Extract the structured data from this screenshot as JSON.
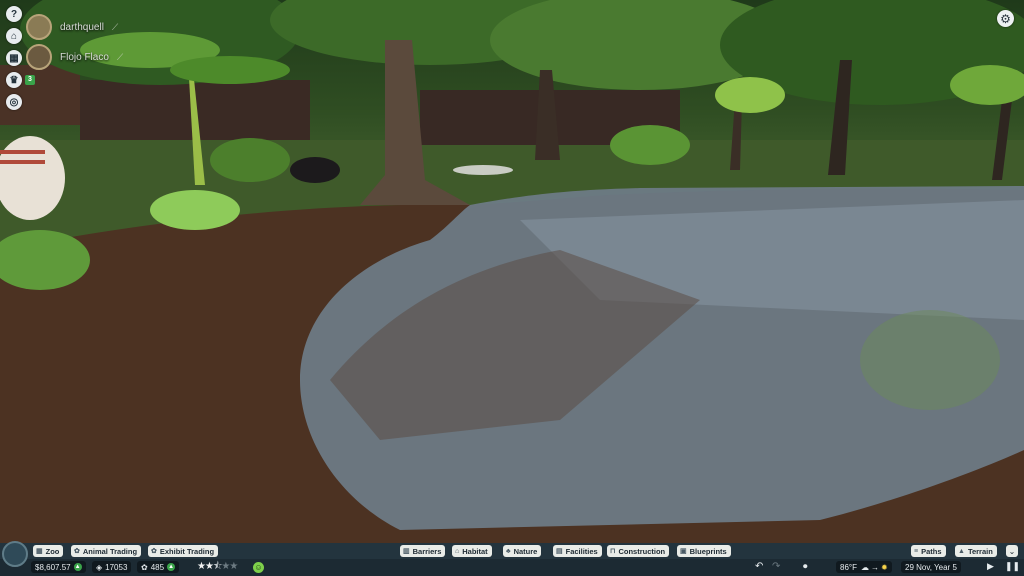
{
  "sidebar": {
    "buttons": [
      {
        "icon": "help-icon",
        "glyph": "?"
      },
      {
        "icon": "zoo-icon",
        "glyph": "⌂"
      },
      {
        "icon": "map-icon",
        "glyph": "▦"
      },
      {
        "icon": "trophy-icon",
        "glyph": "♛",
        "badge": "3"
      },
      {
        "icon": "target-icon",
        "glyph": "◎"
      }
    ]
  },
  "players": [
    {
      "name": "darthquell"
    },
    {
      "name": "Flojo Flaco"
    }
  ],
  "settings": {
    "icon": "gear-icon",
    "glyph": "⚙"
  },
  "bottom_bar": {
    "left_tabs": [
      {
        "label": "Zoo",
        "icon": "zoo-tab-icon"
      },
      {
        "label": "Animal Trading",
        "icon": "paw-icon"
      },
      {
        "label": "Exhibit Trading",
        "icon": "exhibit-icon"
      }
    ],
    "center_tabs": [
      {
        "label": "Barriers",
        "icon": "barrier-icon"
      },
      {
        "label": "Habitat",
        "icon": "habitat-icon"
      },
      {
        "label": "Nature",
        "icon": "nature-icon"
      },
      {
        "label": "Facilities",
        "icon": "facilities-icon"
      },
      {
        "label": "Construction",
        "icon": "construction-icon"
      },
      {
        "label": "Blueprints",
        "icon": "blueprint-icon"
      }
    ],
    "right_tabs": [
      {
        "label": "Paths",
        "icon": "paths-icon"
      },
      {
        "label": "Terrain",
        "icon": "terrain-icon"
      }
    ],
    "money": "$8,607.57",
    "guests": "17053",
    "animals": "485",
    "rating_stars": 2.5,
    "rating_max": 5,
    "temperature": "86°F",
    "date": "29 Nov, Year 5",
    "accent": "#3aa34a"
  }
}
